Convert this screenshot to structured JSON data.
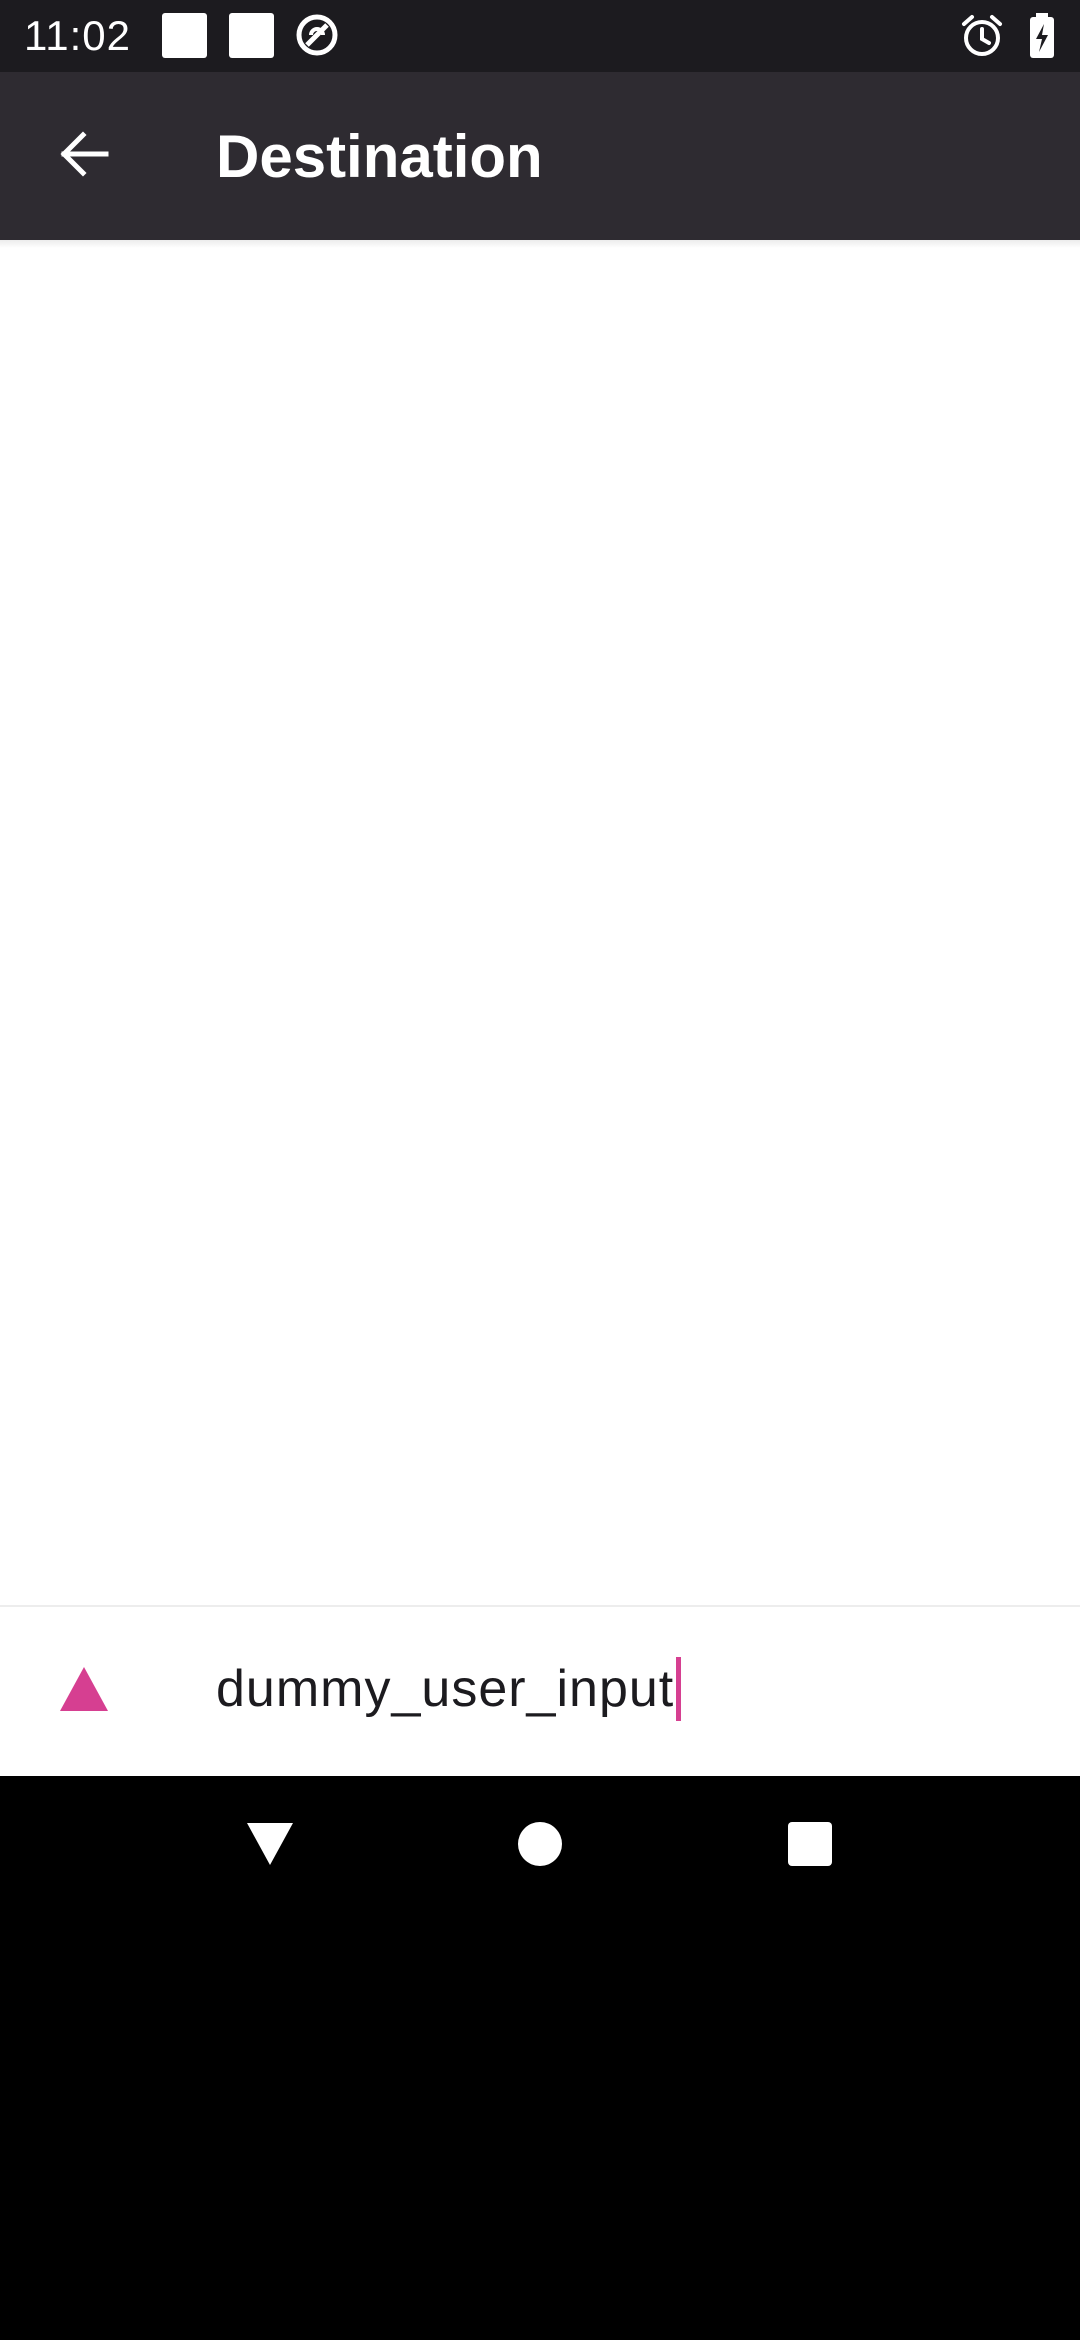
{
  "status_bar": {
    "time": "11:02",
    "left_icons": [
      "notification-square-icon",
      "notification-square-icon",
      "do-not-disturb-icon"
    ],
    "right_icons": [
      "alarm-icon",
      "battery-charging-icon"
    ]
  },
  "app_bar": {
    "back_icon": "arrow-back-icon",
    "title": "Destination"
  },
  "input_bar": {
    "send_icon": "send-triangle-icon",
    "text_value": "dummy_user_input",
    "accent_color": "#d63f91"
  },
  "nav_bar": {
    "buttons": [
      "back-triangle-icon",
      "home-circle-icon",
      "recents-square-icon"
    ]
  },
  "colors": {
    "status_bar": "#1c1b1f",
    "app_bar": "#2e2b31",
    "accent": "#d63f91",
    "surface": "#ffffff",
    "nav_bar": "#000000"
  }
}
